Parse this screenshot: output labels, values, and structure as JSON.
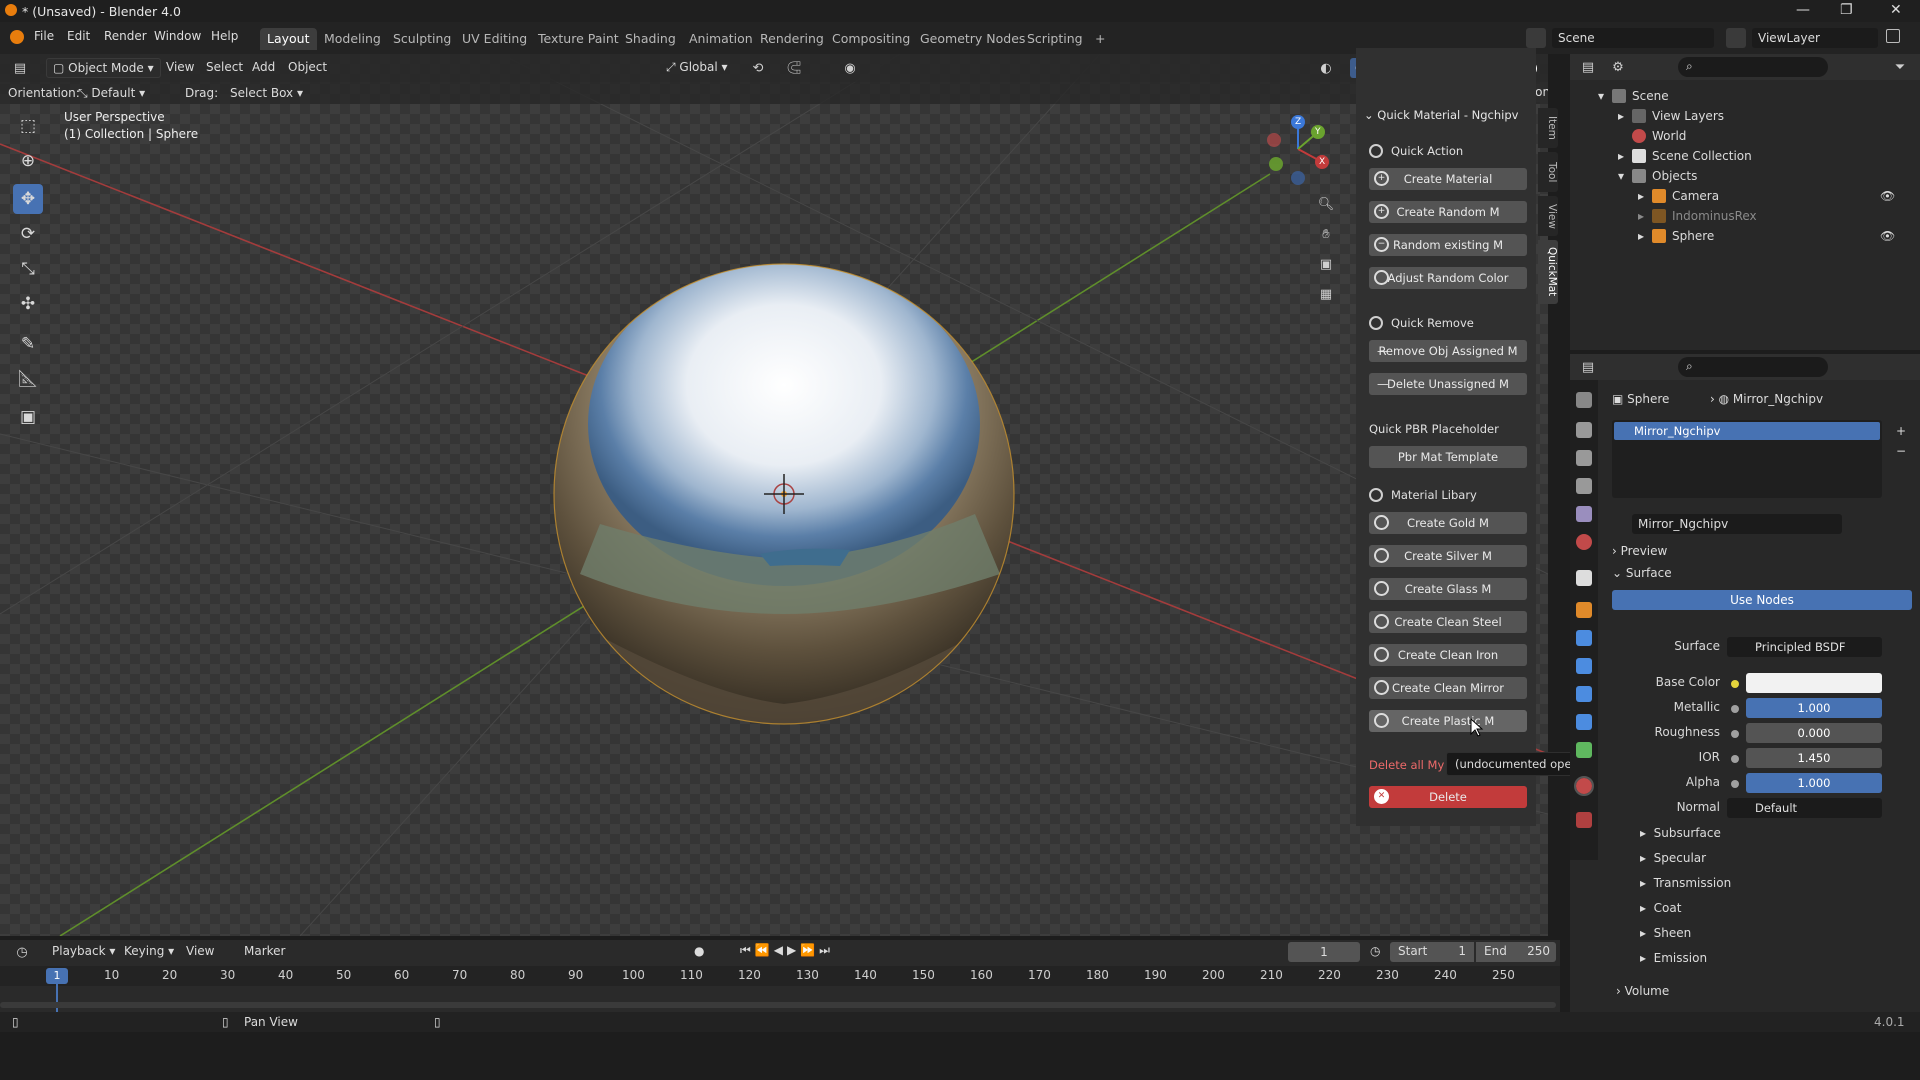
{
  "window": {
    "title": "* (Unsaved) - Blender 4.0",
    "controls": [
      "—",
      "❐",
      "✕"
    ]
  },
  "menu": {
    "items": [
      "File",
      "Edit",
      "Render",
      "Window",
      "Help"
    ]
  },
  "workspaces": {
    "tabs": [
      "Layout",
      "Modeling",
      "Sculpting",
      "UV Editing",
      "Texture Paint",
      "Shading",
      "Animation",
      "Rendering",
      "Compositing",
      "Geometry Nodes",
      "Scripting"
    ],
    "active": "Layout",
    "add": "+"
  },
  "scene": {
    "scene_name": "Scene",
    "view_layer": "ViewLayer"
  },
  "viewport_header": {
    "mode": "Object Mode",
    "menus": [
      "View",
      "Select",
      "Add",
      "Object"
    ],
    "orientation_global": "Global",
    "options": "Options"
  },
  "tool_settings": {
    "orientation_label": "Orientation:",
    "orientation_value": "Default",
    "drag_label": "Drag:",
    "drag_value": "Select Box"
  },
  "viewport_info": {
    "line1": "User Perspective",
    "line2": "(1) Collection | Sphere"
  },
  "gizmo": {
    "x": "X",
    "y": "Y",
    "z": "Z"
  },
  "npanel": {
    "title": "Quick Material - Ngchipv",
    "tabs": [
      "Item",
      "Tool",
      "View",
      "QuickMat"
    ],
    "quick_action": {
      "heading": "Quick Action",
      "buttons": [
        "Create Material",
        "Create Random M",
        "Random existing M",
        "Adjust Random Color"
      ]
    },
    "quick_remove": {
      "heading": "Quick Remove",
      "buttons": [
        "Remove Obj Assigned M",
        "Delete Unassigned M"
      ]
    },
    "pbr": {
      "heading": "Quick PBR Placeholder",
      "button": "Pbr Mat Template"
    },
    "library": {
      "heading": "Material Libary",
      "buttons": [
        "Create Gold M",
        "Create Silver M",
        "Create Glass M",
        "Create Clean Steel",
        "Create Clean Iron",
        "Create Clean Mirror",
        "Create Plastic M"
      ]
    },
    "delete_label": "Delete all My",
    "delete_button": "Delete",
    "tooltip": "(undocumented operator)."
  },
  "outliner": {
    "rows": [
      {
        "label": "Scene"
      },
      {
        "label": "View Layers"
      },
      {
        "label": "World"
      },
      {
        "label": "Scene Collection"
      },
      {
        "label": "Objects"
      },
      {
        "label": "Camera"
      },
      {
        "label": "IndominusRex"
      },
      {
        "label": "Sphere"
      }
    ]
  },
  "properties": {
    "breadcrumb_object": "Sphere",
    "breadcrumb_material": "Mirror_Ngchipv",
    "slot": "Mirror_Ngchipv",
    "material_name": "Mirror_Ngchipv",
    "preview": "Preview",
    "surface_section": "Surface",
    "use_nodes": "Use Nodes",
    "surface_label": "Surface",
    "surface_value": "Principled BSDF",
    "base_color_label": "Base Color",
    "metallic_label": "Metallic",
    "metallic": "1.000",
    "roughness_label": "Roughness",
    "roughness": "0.000",
    "ior_label": "IOR",
    "ior": "1.450",
    "alpha_label": "Alpha",
    "alpha": "1.000",
    "normal_label": "Normal",
    "normal": "Default",
    "subpanels": [
      "Subsurface",
      "Specular",
      "Transmission",
      "Coat",
      "Sheen",
      "Emission"
    ],
    "volume": "Volume"
  },
  "timeline": {
    "menus": [
      "Playback",
      "Keying",
      "View",
      "Marker"
    ],
    "current_frame": "1",
    "start_label": "Start",
    "start": "1",
    "end_label": "End",
    "end": "250",
    "ticks": [
      "1",
      "10",
      "20",
      "30",
      "40",
      "50",
      "60",
      "70",
      "80",
      "90",
      "100",
      "110",
      "120",
      "130",
      "140",
      "150",
      "160",
      "170",
      "180",
      "190",
      "200",
      "210",
      "220",
      "230",
      "240",
      "250"
    ]
  },
  "status": {
    "pan_view": "Pan View",
    "version": "4.0.1"
  },
  "colors": {
    "accent": "#4772b3",
    "delete": "#c23b3b",
    "x_axis": "#c23b3b",
    "y_axis": "#6aa32e",
    "z_axis": "#3b78d8"
  }
}
